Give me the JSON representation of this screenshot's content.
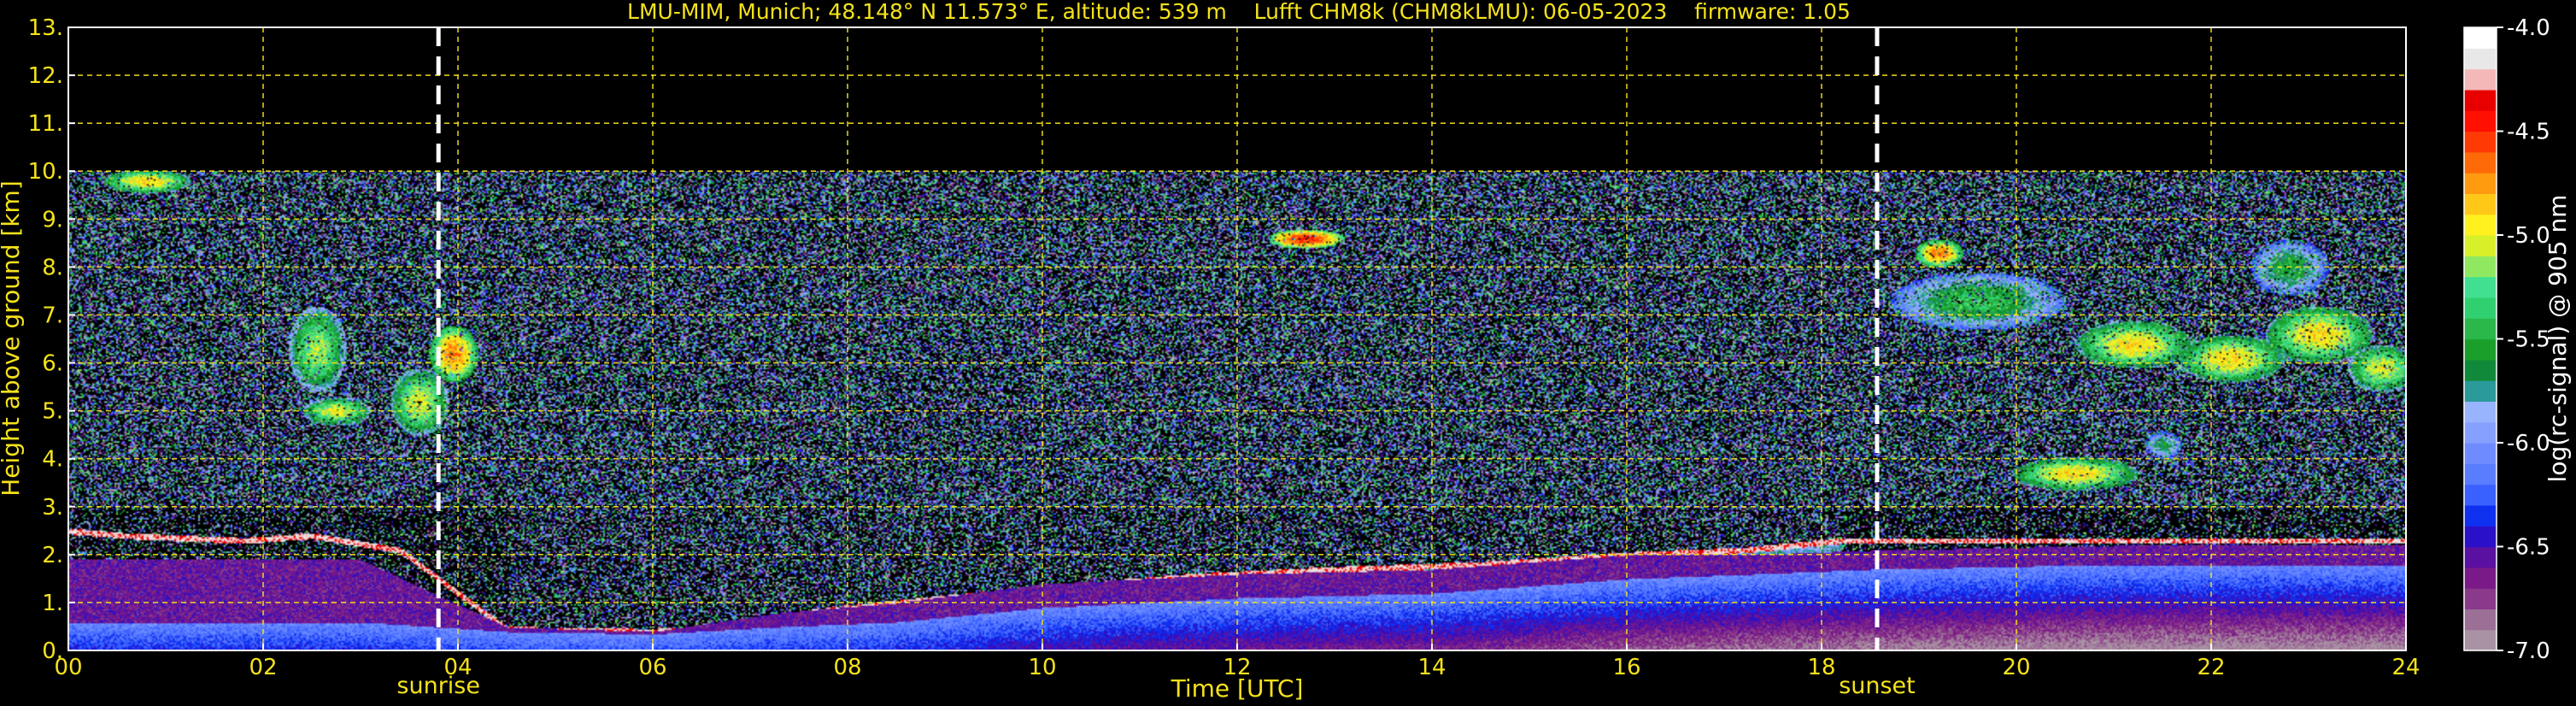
{
  "chart_data": {
    "type": "heatmap",
    "title": "LMU-MIM, Munich; 48.148° N 11.573° E, altitude: 539 m    Lufft CHM8k (CHM8kLMU): 06-05-2023    firmware: 1.05",
    "xlabel": "Time [UTC]",
    "ylabel": "Height above ground [km]",
    "xlim": [
      0,
      24
    ],
    "ylim": [
      0,
      13
    ],
    "x_ticks": [
      0,
      2,
      4,
      6,
      8,
      10,
      12,
      14,
      16,
      18,
      20,
      22,
      24
    ],
    "x_tick_labels": [
      "00",
      "02",
      "04",
      "06",
      "08",
      "10",
      "12",
      "14",
      "16",
      "18",
      "20",
      "22",
      "24"
    ],
    "y_ticks": [
      0,
      1,
      2,
      3,
      4,
      5,
      6,
      7,
      8,
      9,
      10,
      11,
      12,
      13
    ],
    "y_tick_labels": [
      "0.",
      "1.",
      "2.",
      "3.",
      "4.",
      "5.",
      "6.",
      "7.",
      "8.",
      "9.",
      "10.",
      "11.",
      "12.",
      "13."
    ],
    "grid": true,
    "data_top_km": 10,
    "events": [
      {
        "label": "sunrise",
        "time": 3.8
      },
      {
        "label": "sunset",
        "time": 18.57
      }
    ],
    "colorbar": {
      "label": "log(rc-signal) @ 905 nm",
      "range": [
        -7.0,
        -4.0
      ],
      "ticks": [
        -4.0,
        -4.5,
        -5.0,
        -5.5,
        -6.0,
        -6.5,
        -7.0
      ],
      "tick_labels": [
        "-4.0",
        "-4.5",
        "-5.0",
        "-5.5",
        "-6.0",
        "-6.5",
        "-7.0"
      ],
      "colors": [
        "#a992a4",
        "#9c6f97",
        "#8a3a8a",
        "#7a1a88",
        "#5a10a0",
        "#2a10c8",
        "#1030f0",
        "#3a60ff",
        "#5a7cff",
        "#6e8cff",
        "#86a0ff",
        "#98b4ff",
        "#2a9a9a",
        "#108a3a",
        "#1aa02a",
        "#2ab84a",
        "#30d070",
        "#40e090",
        "#90e860",
        "#d8f02a",
        "#fff020",
        "#ffc818",
        "#ff9a10",
        "#ff6a08",
        "#ff3a04",
        "#ff1000",
        "#e80000",
        "#f4b8b8",
        "#e8e8e8",
        "#ffffff"
      ],
      "bg_color": "#000000"
    },
    "layers": [
      {
        "name": "aerosol",
        "segments": [
          [
            0,
            0.6,
            1.9
          ],
          [
            3,
            0.6,
            1.9
          ],
          [
            4.5,
            0.4,
            0.5
          ],
          [
            6,
            0.35,
            0.4
          ],
          [
            7.3,
            0.5,
            0.8
          ],
          [
            8.5,
            0.6,
            1.0
          ],
          [
            10,
            0.9,
            1.4
          ],
          [
            12,
            1.1,
            1.6
          ],
          [
            14,
            1.2,
            1.7
          ],
          [
            16,
            1.5,
            2.0
          ],
          [
            17.3,
            1.6,
            2.0
          ],
          [
            18.5,
            1.7,
            2.1
          ],
          [
            21,
            1.8,
            2.2
          ],
          [
            24,
            1.8,
            2.2
          ]
        ]
      },
      {
        "name": "boundary_top",
        "points": [
          [
            0,
            2.5
          ],
          [
            0.6,
            2.4
          ],
          [
            1.8,
            2.3
          ],
          [
            2.5,
            2.4
          ],
          [
            3.4,
            2.1
          ],
          [
            4.5,
            0.45
          ],
          [
            6,
            0.4
          ],
          [
            7.2,
            0.55
          ],
          [
            7.6,
            0.8
          ],
          [
            8.5,
            1.0
          ],
          [
            10,
            1.3
          ],
          [
            11.5,
            1.55
          ],
          [
            13,
            1.7
          ],
          [
            14.5,
            1.8
          ],
          [
            16,
            2.0
          ],
          [
            17.2,
            2.1
          ],
          [
            18.2,
            2.3
          ]
        ]
      }
    ],
    "clouds": [
      {
        "t": 0.8,
        "h": 9.8,
        "dt": 0.45,
        "dh": 0.25,
        "v": -4.9
      },
      {
        "t": 2.55,
        "h": 6.3,
        "dt": 0.3,
        "dh": 0.9,
        "v": -5.1
      },
      {
        "t": 2.75,
        "h": 5.0,
        "dt": 0.35,
        "dh": 0.3,
        "v": -5.0
      },
      {
        "t": 3.95,
        "h": 6.2,
        "dt": 0.25,
        "dh": 0.6,
        "v": -4.7
      },
      {
        "t": 3.6,
        "h": 5.2,
        "dt": 0.3,
        "dh": 0.7,
        "v": -5.0
      },
      {
        "t": 12.7,
        "h": 8.6,
        "dt": 0.4,
        "dh": 0.2,
        "v": -4.5
      },
      {
        "t": 19.2,
        "h": 8.3,
        "dt": 0.25,
        "dh": 0.3,
        "v": -4.7
      },
      {
        "t": 19.6,
        "h": 7.3,
        "dt": 0.9,
        "dh": 0.6,
        "v": -5.4
      },
      {
        "t": 20.6,
        "h": 3.7,
        "dt": 0.65,
        "dh": 0.35,
        "v": -4.9
      },
      {
        "t": 21.2,
        "h": 6.4,
        "dt": 0.6,
        "dh": 0.5,
        "v": -4.9
      },
      {
        "t": 22.2,
        "h": 6.1,
        "dt": 0.55,
        "dh": 0.5,
        "v": -4.9
      },
      {
        "t": 23.1,
        "h": 6.6,
        "dt": 0.55,
        "dh": 0.6,
        "v": -4.9
      },
      {
        "t": 23.75,
        "h": 5.9,
        "dt": 0.35,
        "dh": 0.5,
        "v": -5.0
      },
      {
        "t": 22.8,
        "h": 8.0,
        "dt": 0.4,
        "dh": 0.6,
        "v": -5.5
      },
      {
        "t": 21.5,
        "h": 4.3,
        "dt": 0.2,
        "dh": 0.3,
        "v": -5.6
      }
    ]
  }
}
